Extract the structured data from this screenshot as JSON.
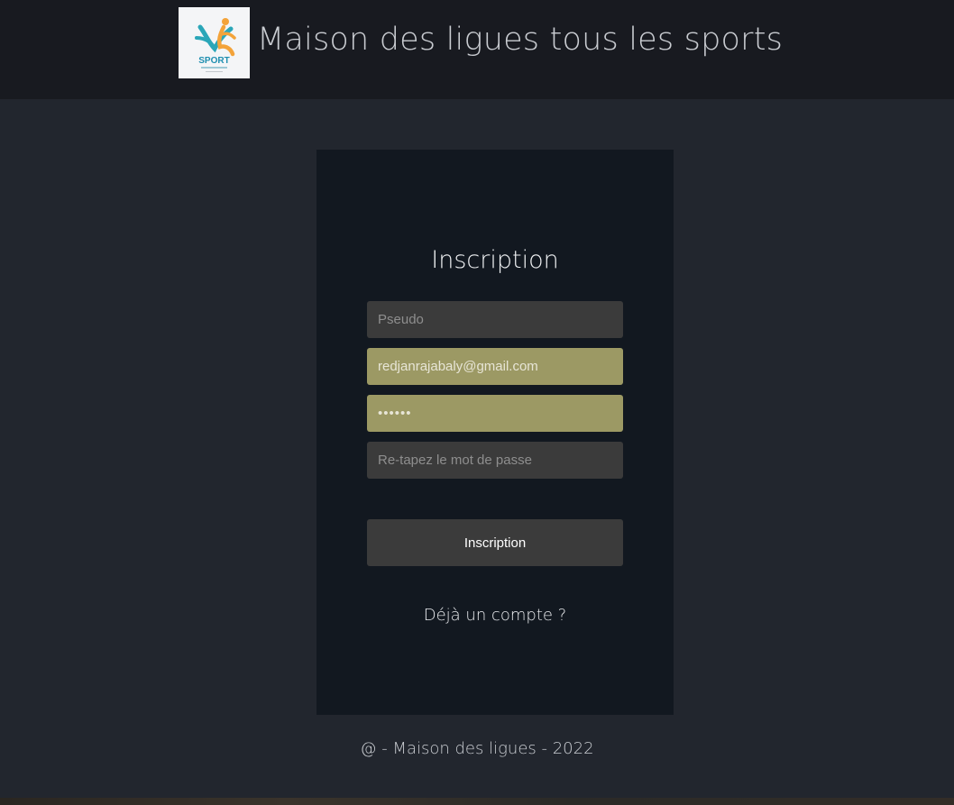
{
  "header": {
    "title": "Maison des ligues tous les sports",
    "logo": {
      "icon": "sport-logo-icon",
      "text": "SPORT"
    }
  },
  "form": {
    "title": "Inscription",
    "fields": {
      "pseudo": {
        "placeholder": "Pseudo",
        "value": ""
      },
      "email": {
        "placeholder": "",
        "value": "redjanrajabaly@gmail.com"
      },
      "password": {
        "placeholder": "",
        "value": "••••••"
      },
      "retype": {
        "placeholder": "Re-tapez le mot de passe",
        "value": ""
      }
    },
    "submit_label": "Inscription",
    "login_link": "Déjà un compte ?"
  },
  "footer": {
    "text": "@ - Maison des ligues - 2022"
  },
  "colors": {
    "background": "#22262e",
    "header": "#181a20",
    "card": "#121820",
    "field": "#3b3b3b",
    "autofill": "#9c9964"
  }
}
